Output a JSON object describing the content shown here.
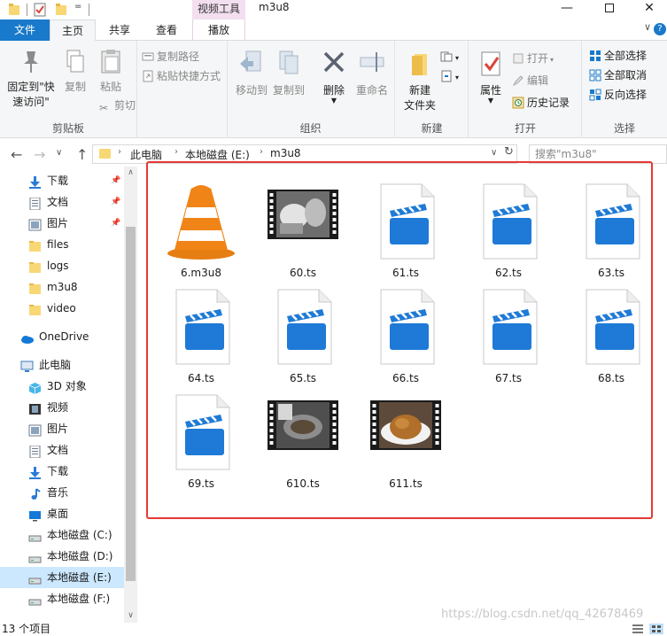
{
  "titlebar": {
    "qa_menu": "=",
    "context_tab_header": "视频工具",
    "window_title": "m3u8",
    "minimize": "—",
    "close": "✕"
  },
  "tabs": {
    "file": "文件",
    "home": "主页",
    "share": "共享",
    "view": "查看",
    "play": "播放",
    "expand": "∨",
    "help": "?"
  },
  "ribbon": {
    "clipboard": {
      "label": "剪贴板",
      "pin": "固定到\"快速访问\"",
      "copy": "复制",
      "paste": "粘贴",
      "cut": "剪切",
      "copy_path": "复制路径",
      "paste_shortcut": "粘贴快捷方式"
    },
    "organize": {
      "label": "组织",
      "move_to": "移动到",
      "copy_to": "复制到",
      "delete": "删除",
      "rename": "重命名"
    },
    "new": {
      "label": "新建",
      "new_folder": "新建\n文件夹"
    },
    "open": {
      "label": "打开",
      "properties": "属性",
      "open": "打开",
      "edit": "编辑",
      "history": "历史记录"
    },
    "select": {
      "label": "选择",
      "select_all": "全部选择",
      "select_none": "全部取消",
      "invert": "反向选择"
    }
  },
  "address": {
    "crumbs": [
      "此电脑",
      "本地磁盘 (E:)",
      "m3u8"
    ],
    "search_placeholder": "搜索\"m3u8\""
  },
  "nav": {
    "quick_access": [
      {
        "label": "下载",
        "icon": "download-icon",
        "pinned": true
      },
      {
        "label": "文档",
        "icon": "document-icon",
        "pinned": true
      },
      {
        "label": "图片",
        "icon": "picture-icon",
        "pinned": true
      },
      {
        "label": "files",
        "icon": "folder-icon",
        "pinned": false
      },
      {
        "label": "logs",
        "icon": "folder-icon",
        "pinned": false
      },
      {
        "label": "m3u8",
        "icon": "folder-icon",
        "pinned": false
      },
      {
        "label": "video",
        "icon": "folder-icon",
        "pinned": false
      }
    ],
    "onedrive": "OneDrive",
    "this_pc": "此电脑",
    "pc_items": [
      {
        "label": "3D 对象",
        "icon": "3d-objects-icon"
      },
      {
        "label": "视频",
        "icon": "video-icon"
      },
      {
        "label": "图片",
        "icon": "picture-icon"
      },
      {
        "label": "文档",
        "icon": "document-icon"
      },
      {
        "label": "下载",
        "icon": "download-icon"
      },
      {
        "label": "音乐",
        "icon": "music-icon"
      },
      {
        "label": "桌面",
        "icon": "desktop-icon"
      },
      {
        "label": "本地磁盘 (C:)",
        "icon": "drive-icon"
      },
      {
        "label": "本地磁盘 (D:)",
        "icon": "drive-icon"
      },
      {
        "label": "本地磁盘 (E:)",
        "icon": "drive-icon",
        "selected": true
      },
      {
        "label": "本地磁盘 (F:)",
        "icon": "drive-icon"
      }
    ]
  },
  "files": [
    {
      "name": "6.m3u8",
      "type": "vlc"
    },
    {
      "name": "60.ts",
      "type": "video-thumb-kitchen"
    },
    {
      "name": "61.ts",
      "type": "clapper"
    },
    {
      "name": "62.ts",
      "type": "clapper"
    },
    {
      "name": "63.ts",
      "type": "clapper"
    },
    {
      "name": "64.ts",
      "type": "clapper"
    },
    {
      "name": "65.ts",
      "type": "clapper"
    },
    {
      "name": "66.ts",
      "type": "clapper"
    },
    {
      "name": "67.ts",
      "type": "clapper"
    },
    {
      "name": "68.ts",
      "type": "clapper"
    },
    {
      "name": "69.ts",
      "type": "clapper"
    },
    {
      "name": "610.ts",
      "type": "video-thumb-pan"
    },
    {
      "name": "611.ts",
      "type": "video-thumb-rice"
    }
  ],
  "status": {
    "item_count": "13 个项目",
    "watermark": "https://blog.csdn.net/qq_42678469"
  },
  "colors": {
    "accent": "#1979ca",
    "selection": "#cce8ff",
    "highlight_border": "#e53935",
    "folder": "#f8d775",
    "clapper_blue": "#1e7ad6"
  }
}
